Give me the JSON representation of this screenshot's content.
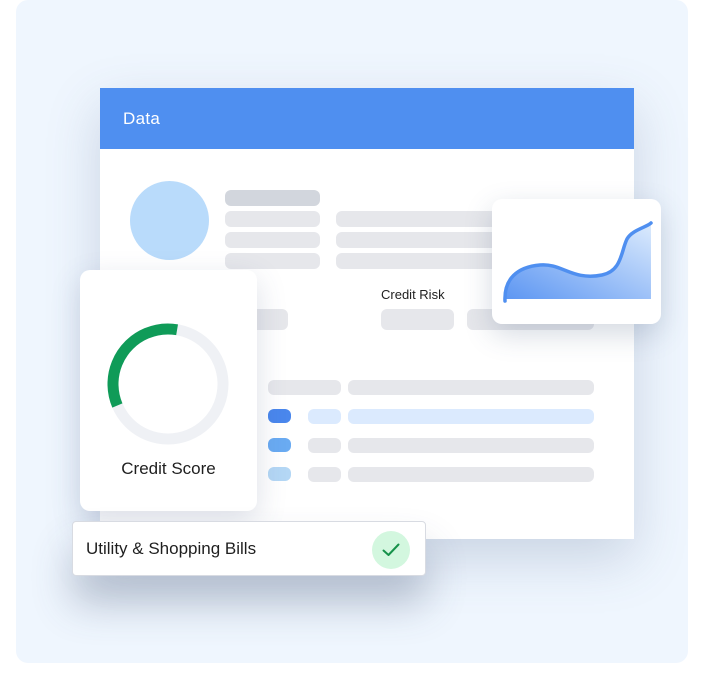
{
  "main_card": {
    "header_title": "Data",
    "header_color": "#4f8ff0"
  },
  "profile": {
    "avatar_icon": "avatar-placeholder-icon"
  },
  "credit_risk": {
    "label": "Credit Risk"
  },
  "credit_score": {
    "label": "Credit Score",
    "progress": 0.34,
    "progress_color": "#0f9b58",
    "track_color": "#eff1f5"
  },
  "trend_chart": {
    "icon": "area-chart-icon",
    "line_color": "#4f8ff0"
  },
  "list_rows": [
    {
      "status_color": "#4a87ed",
      "highlighted": true
    },
    {
      "status_color": "#6aabf2",
      "highlighted": false
    },
    {
      "status_color": "#b4d7f5",
      "highlighted": false
    }
  ],
  "bills": {
    "label": "Utility & Shopping Bills",
    "status_icon": "check-icon",
    "status": "verified"
  }
}
